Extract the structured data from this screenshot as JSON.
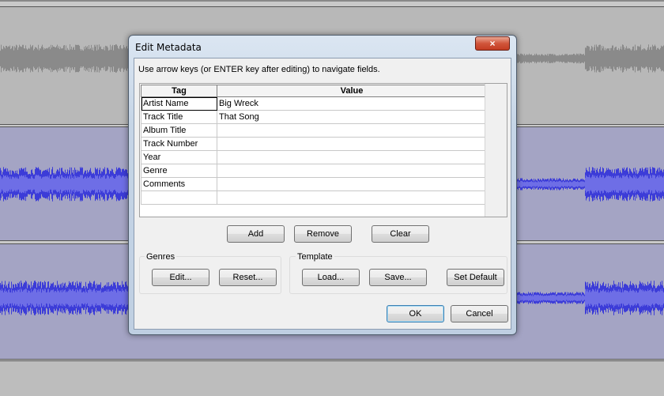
{
  "dialog": {
    "title": "Edit Metadata",
    "close_icon": "×",
    "instruction": "Use arrow keys (or ENTER key after editing) to navigate fields."
  },
  "grid": {
    "headers": [
      "Tag",
      "Value"
    ],
    "rows": [
      {
        "tag": "Artist Name",
        "value": "Big Wreck"
      },
      {
        "tag": "Track Title",
        "value": "That Song"
      },
      {
        "tag": "Album Title",
        "value": ""
      },
      {
        "tag": "Track Number",
        "value": ""
      },
      {
        "tag": "Year",
        "value": ""
      },
      {
        "tag": "Genre",
        "value": ""
      },
      {
        "tag": "Comments",
        "value": ""
      },
      {
        "tag": "",
        "value": ""
      }
    ]
  },
  "buttons": {
    "add": "Add",
    "remove": "Remove",
    "clear": "Clear",
    "genres_edit": "Edit...",
    "genres_reset": "Reset...",
    "template_load": "Load...",
    "template_save": "Save...",
    "template_set_default": "Set Default",
    "ok": "OK",
    "cancel": "Cancel"
  },
  "groups": {
    "genres": "Genres",
    "template": "Template"
  },
  "colors": {
    "track_gray_wave": "#8a8a8a",
    "track_blue_wave": "#3c3cd8",
    "track_blue_light": "#6e6ee6",
    "dialog_frame": "#c6d5e6",
    "close_button": "#c94a30"
  }
}
